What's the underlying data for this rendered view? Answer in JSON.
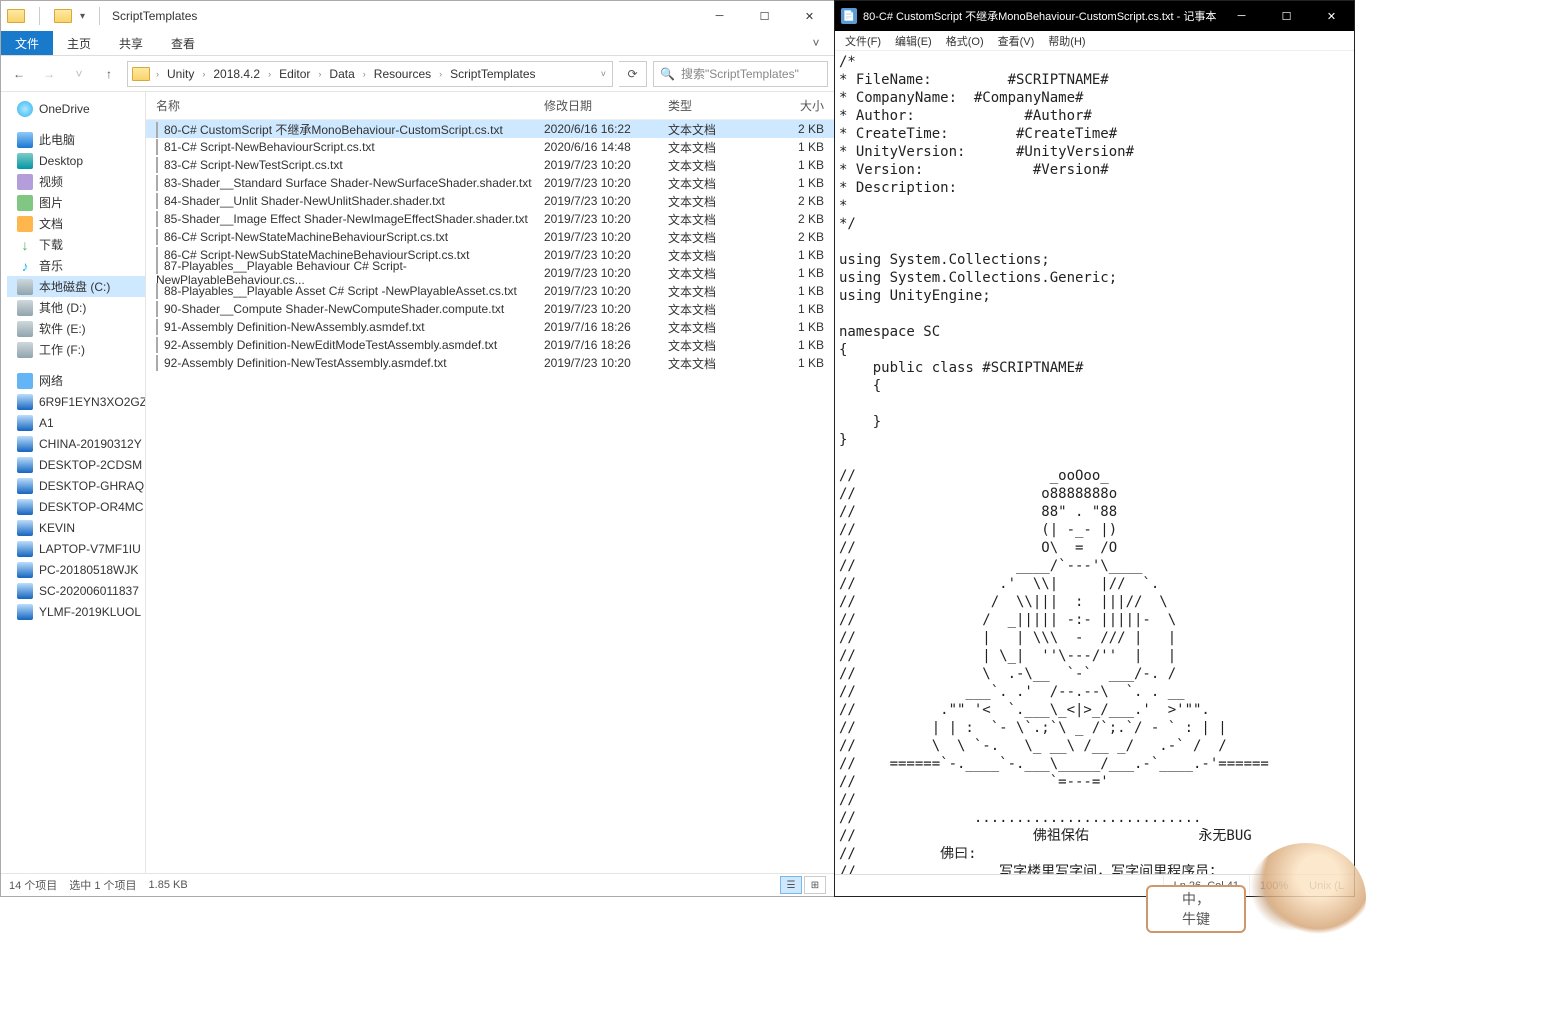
{
  "explorer": {
    "title": "ScriptTemplates",
    "ribbon": {
      "file": "文件",
      "home": "主页",
      "share": "共享",
      "view": "查看"
    },
    "breadcrumbs": [
      "Unity",
      "2018.4.2",
      "Editor",
      "Data",
      "Resources",
      "ScriptTemplates"
    ],
    "search_placeholder": "搜索\"ScriptTemplates\"",
    "columns": {
      "name": "名称",
      "date": "修改日期",
      "type": "类型",
      "size": "大小"
    },
    "tree": {
      "onedrive": "OneDrive",
      "pc": "此电脑",
      "desktop": "Desktop",
      "video": "视频",
      "pictures": "图片",
      "documents": "文档",
      "downloads": "下载",
      "music": "音乐",
      "diskC": "本地磁盘 (C:)",
      "diskD": "其他 (D:)",
      "diskE": "软件 (E:)",
      "diskF": "工作 (F:)",
      "network": "网络",
      "hosts": [
        "6R9F1EYN3XO2GZ",
        "A1",
        "CHINA-20190312Y",
        "DESKTOP-2CDSM",
        "DESKTOP-GHRAQ",
        "DESKTOP-OR4MC",
        "KEVIN",
        "LAPTOP-V7MF1IU",
        "PC-20180518WJK",
        "SC-202006011837",
        "YLMF-2019KLUOL"
      ]
    },
    "files": [
      {
        "name": "80-C# CustomScript 不继承MonoBehaviour-CustomScript.cs.txt",
        "date": "2020/6/16 16:22",
        "type": "文本文档",
        "size": "2 KB",
        "selected": true
      },
      {
        "name": "81-C# Script-NewBehaviourScript.cs.txt",
        "date": "2020/6/16 14:48",
        "type": "文本文档",
        "size": "1 KB"
      },
      {
        "name": "83-C# Script-NewTestScript.cs.txt",
        "date": "2019/7/23 10:20",
        "type": "文本文档",
        "size": "1 KB"
      },
      {
        "name": "83-Shader__Standard Surface Shader-NewSurfaceShader.shader.txt",
        "date": "2019/7/23 10:20",
        "type": "文本文档",
        "size": "1 KB"
      },
      {
        "name": "84-Shader__Unlit Shader-NewUnlitShader.shader.txt",
        "date": "2019/7/23 10:20",
        "type": "文本文档",
        "size": "2 KB"
      },
      {
        "name": "85-Shader__Image Effect Shader-NewImageEffectShader.shader.txt",
        "date": "2019/7/23 10:20",
        "type": "文本文档",
        "size": "2 KB"
      },
      {
        "name": "86-C# Script-NewStateMachineBehaviourScript.cs.txt",
        "date": "2019/7/23 10:20",
        "type": "文本文档",
        "size": "2 KB"
      },
      {
        "name": "86-C# Script-NewSubStateMachineBehaviourScript.cs.txt",
        "date": "2019/7/23 10:20",
        "type": "文本文档",
        "size": "1 KB"
      },
      {
        "name": "87-Playables__Playable Behaviour C# Script-NewPlayableBehaviour.cs...",
        "date": "2019/7/23 10:20",
        "type": "文本文档",
        "size": "1 KB"
      },
      {
        "name": "88-Playables__Playable Asset C# Script -NewPlayableAsset.cs.txt",
        "date": "2019/7/23 10:20",
        "type": "文本文档",
        "size": "1 KB"
      },
      {
        "name": "90-Shader__Compute Shader-NewComputeShader.compute.txt",
        "date": "2019/7/23 10:20",
        "type": "文本文档",
        "size": "1 KB"
      },
      {
        "name": "91-Assembly Definition-NewAssembly.asmdef.txt",
        "date": "2019/7/16 18:26",
        "type": "文本文档",
        "size": "1 KB"
      },
      {
        "name": "92-Assembly Definition-NewEditModeTestAssembly.asmdef.txt",
        "date": "2019/7/16 18:26",
        "type": "文本文档",
        "size": "1 KB"
      },
      {
        "name": "92-Assembly Definition-NewTestAssembly.asmdef.txt",
        "date": "2019/7/23 10:20",
        "type": "文本文档",
        "size": "1 KB"
      }
    ],
    "status": {
      "items": "14 个项目",
      "selected": "选中 1 个项目",
      "size": "1.85 KB"
    }
  },
  "notepad": {
    "title": "80-C# CustomScript 不继承MonoBehaviour-CustomScript.cs.txt - 记事本",
    "menus": {
      "file": "文件(F)",
      "edit": "编辑(E)",
      "format": "格式(O)",
      "view": "查看(V)",
      "help": "帮助(H)"
    },
    "content": "/*\n* FileName:         #SCRIPTNAME#\n* CompanyName:  #CompanyName#\n* Author:             #Author#\n* CreateTime:        #CreateTime#\n* UnityVersion:      #UnityVersion#\n* Version:             #Version#\n* Description:        \n* \n*/\n\nusing System.Collections;\nusing System.Collections.Generic;\nusing UnityEngine;\n\nnamespace SC\n{\n    public class #SCRIPTNAME#\n    {\n        \n    }\n}\n\n//                       _ooOoo_\n//                      o8888888o\n//                      88\" . \"88\n//                      (| -_- |)\n//                      O\\  =  /O\n//                   ____/`---'\\____\n//                 .'  \\\\|     |//  `.\n//                /  \\\\|||  :  |||//  \\\n//               /  _||||| -:- |||||-  \\\n//               |   | \\\\\\  -  /// |   |\n//               | \\_|  ''\\---/''  |   |\n//               \\  .-\\__  `-`  ___/-. /\n//             ___`. .'  /--.--\\  `. . __\n//          .\"\" '<  `.___\\_<|>_/___.'  >'\"\".\n//         | | :  `- \\`.;`\\ _ /`;.`/ - ` : | |\n//         \\  \\ `-.   \\_ __\\ /__ _/   .-` /  /\n//    ======`-.____`-.___\\_____/___.-`____.-'======\n//                       `=---='\n//\n//              ........................... \n//                     佛祖保佑             永无BUG\n//          佛曰:\n//                 写字楼里写字间，写字间里程序员；",
    "status": {
      "pos": "Ln 26,  Col 41",
      "zoom": "100%",
      "eol": "Unix (L"
    }
  },
  "sticker": {
    "text": "中，\n牛键"
  }
}
